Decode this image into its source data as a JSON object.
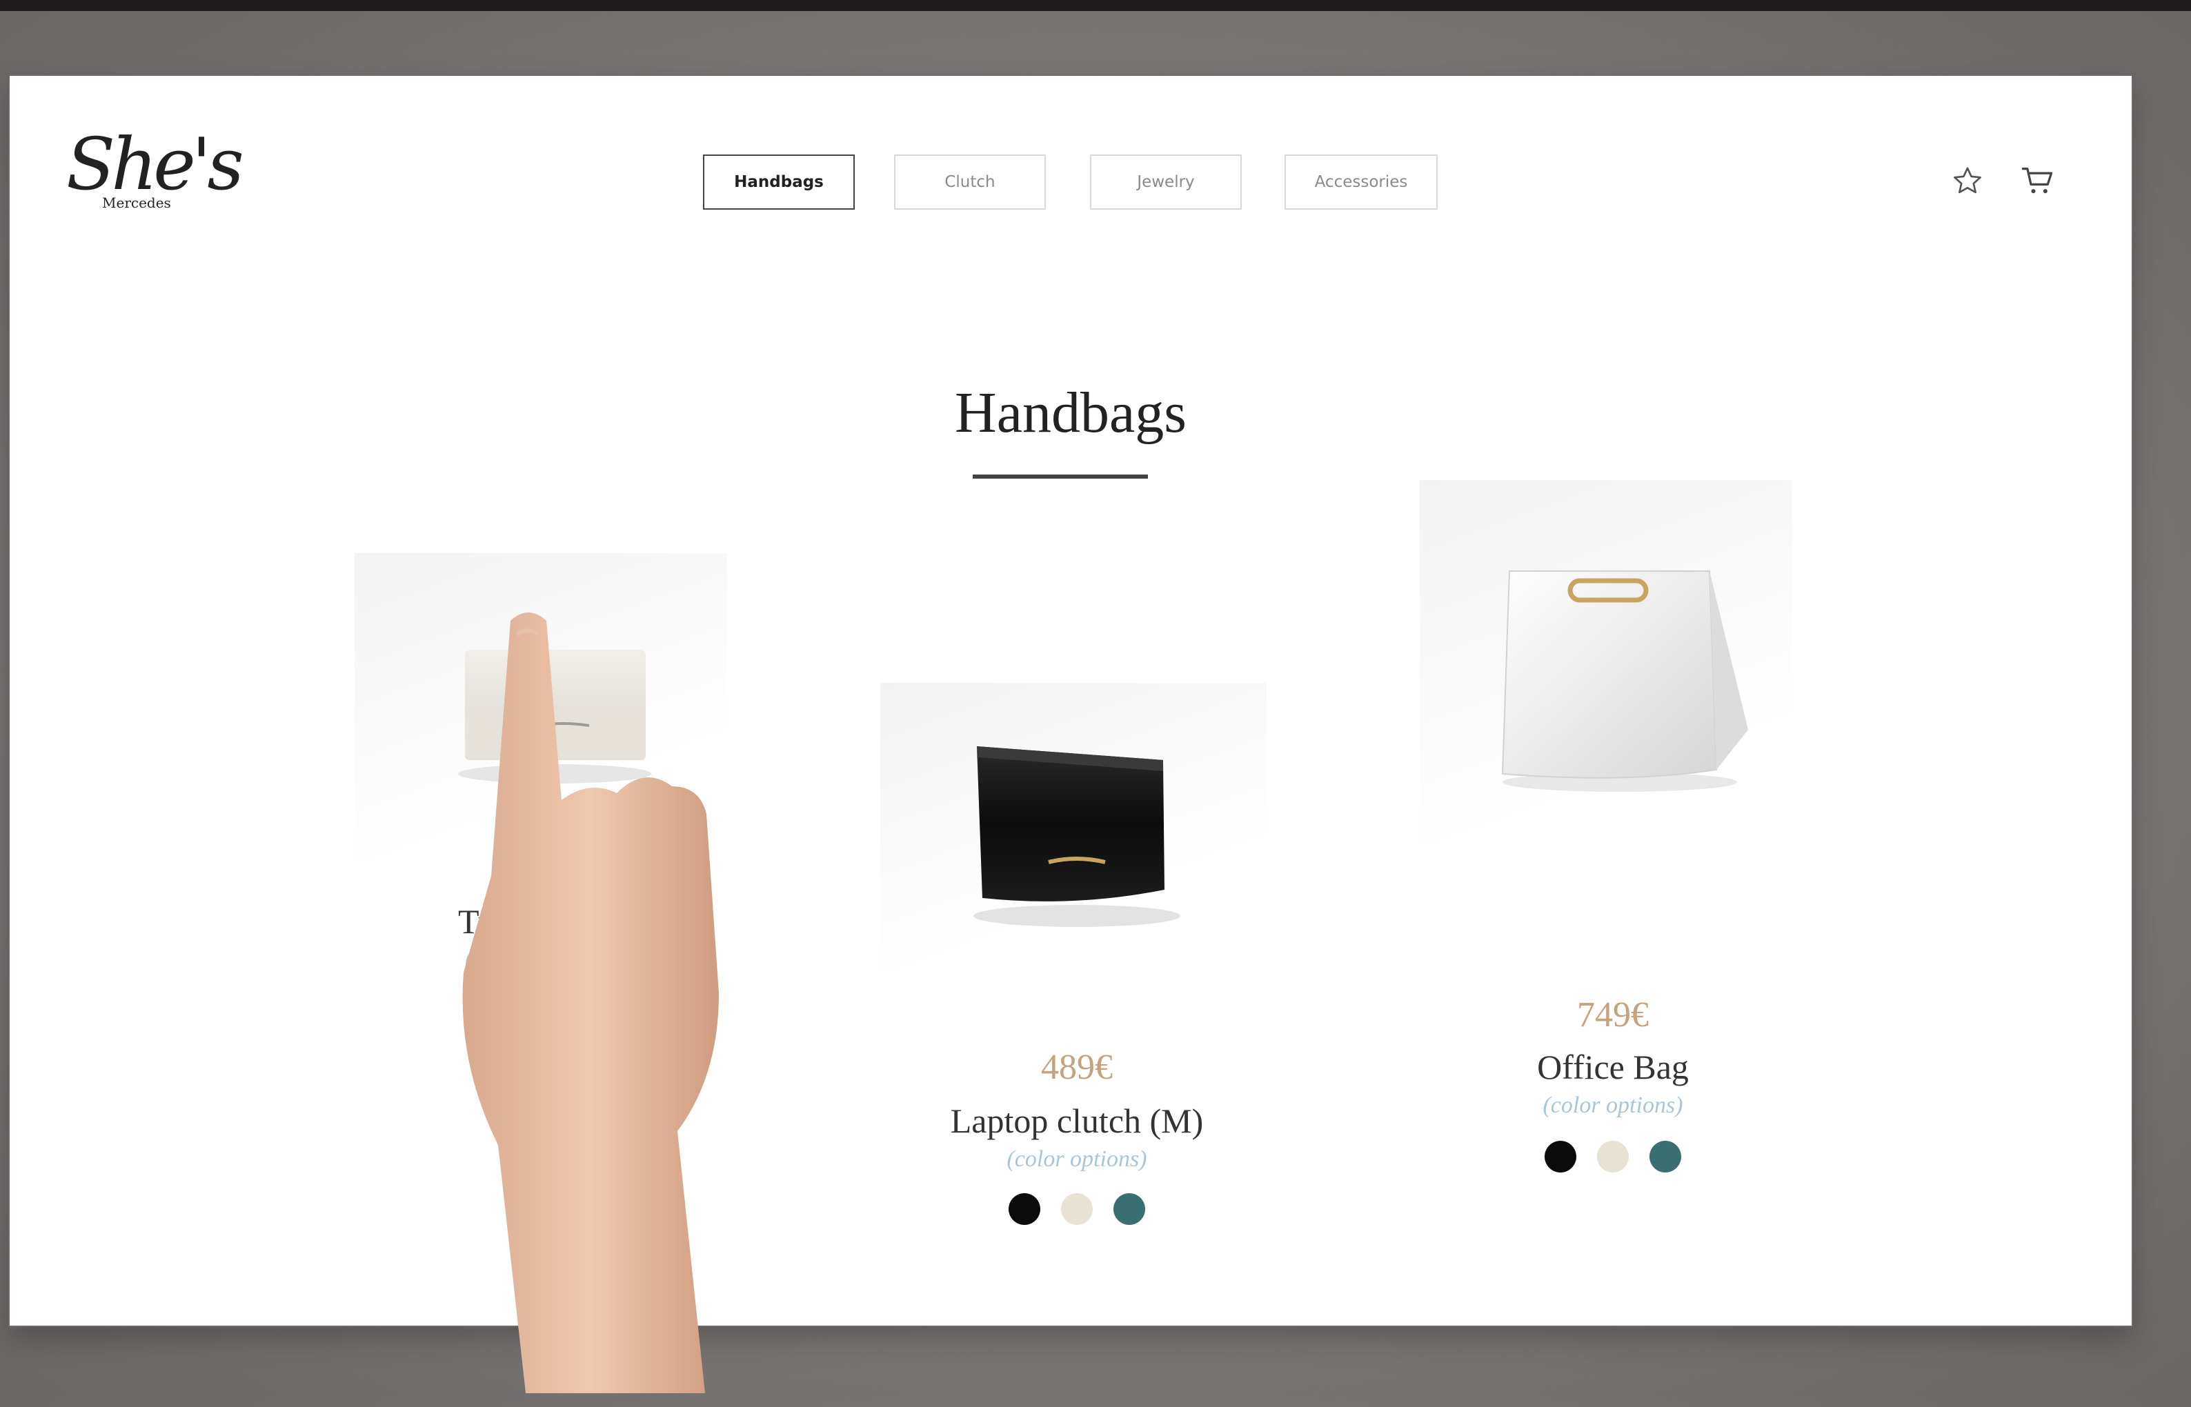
{
  "brand": {
    "script": "She's",
    "sub": "Mercedes"
  },
  "nav": {
    "items": [
      {
        "label": "Handbags",
        "active": true
      },
      {
        "label": "Clutch",
        "active": false
      },
      {
        "label": "Jewelry",
        "active": false
      },
      {
        "label": "Accessories",
        "active": false
      }
    ]
  },
  "icons": {
    "favorites": "star-icon",
    "cart": "cart-icon"
  },
  "page": {
    "title": "Handbags"
  },
  "products": [
    {
      "name": "Tra",
      "options_label": "(",
      "swatches": [
        "#111111"
      ],
      "color": "#eeeae4"
    },
    {
      "name": "Laptop clutch (M)",
      "price": "489€",
      "options_label": "(color options)",
      "swatches": [
        "#0b0b0b",
        "#e8e2d4",
        "#3a6f72"
      ],
      "color": "#121212"
    },
    {
      "name": "Office Bag",
      "price": "749€",
      "options_label": "(color options)",
      "swatches": [
        "#0b0b0b",
        "#e8e2d4",
        "#3a6f72"
      ],
      "color": "#f4f4f4"
    }
  ],
  "colors": {
    "price": "#c4a37e",
    "options": "#a9c6d9",
    "accent": "#444444"
  }
}
